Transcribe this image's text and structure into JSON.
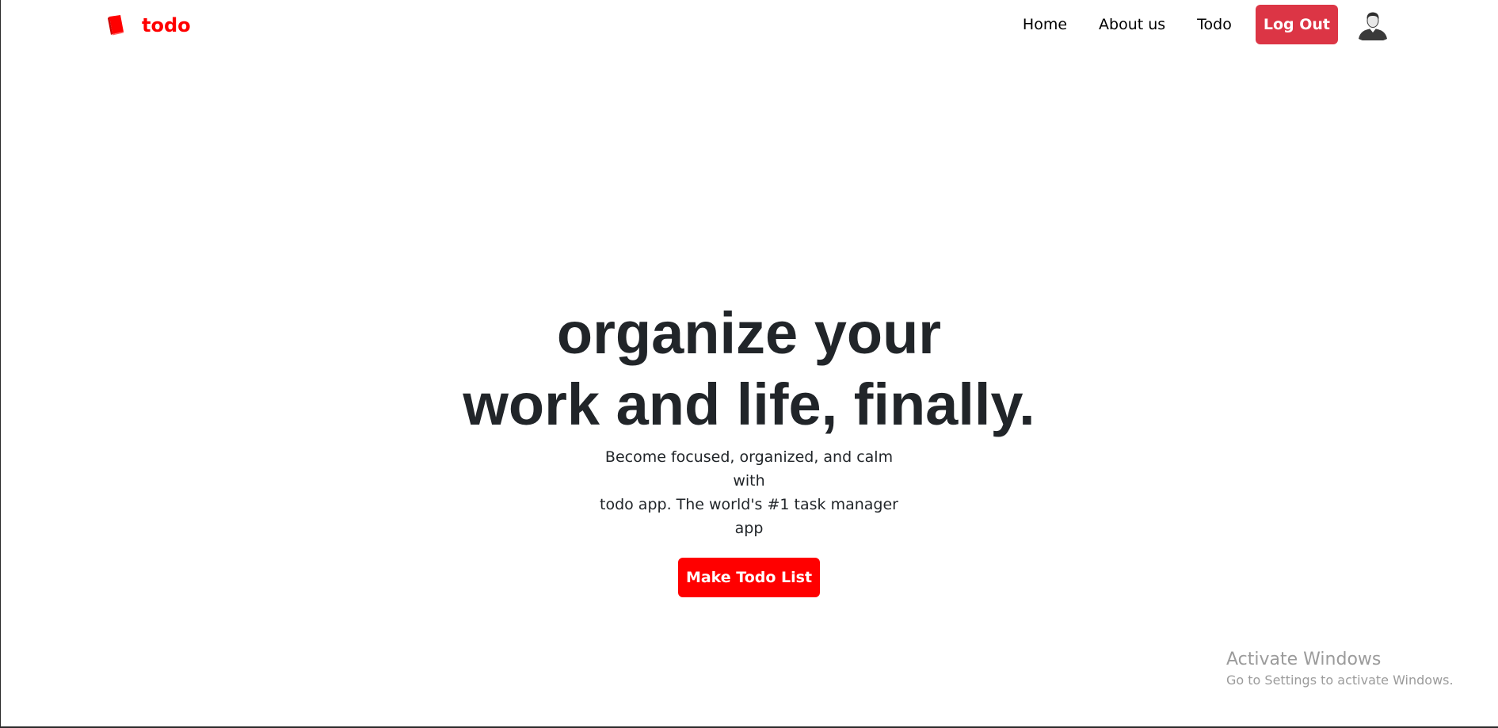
{
  "navbar": {
    "brand": {
      "icon": "book-icon",
      "label": "todo"
    },
    "links": [
      {
        "label": "Home"
      },
      {
        "label": "About us"
      },
      {
        "label": "Todo"
      }
    ],
    "logout_label": "Log Out",
    "avatar_icon": "user-avatar-icon"
  },
  "hero": {
    "title_line1": "organize your",
    "title_line2": "work and life, finally.",
    "subtitle_line1": "Become focused, organized, and calm with",
    "subtitle_line2": "todo app. The world's #1 task manager app",
    "cta_label": "Make Todo List"
  },
  "watermark": {
    "title": "Activate Windows",
    "subtitle": "Go to Settings to activate Windows."
  },
  "colors": {
    "brand": "#ff0000",
    "logout_button": "#dc3545",
    "cta_button": "#ff0000",
    "text": "#212529"
  }
}
